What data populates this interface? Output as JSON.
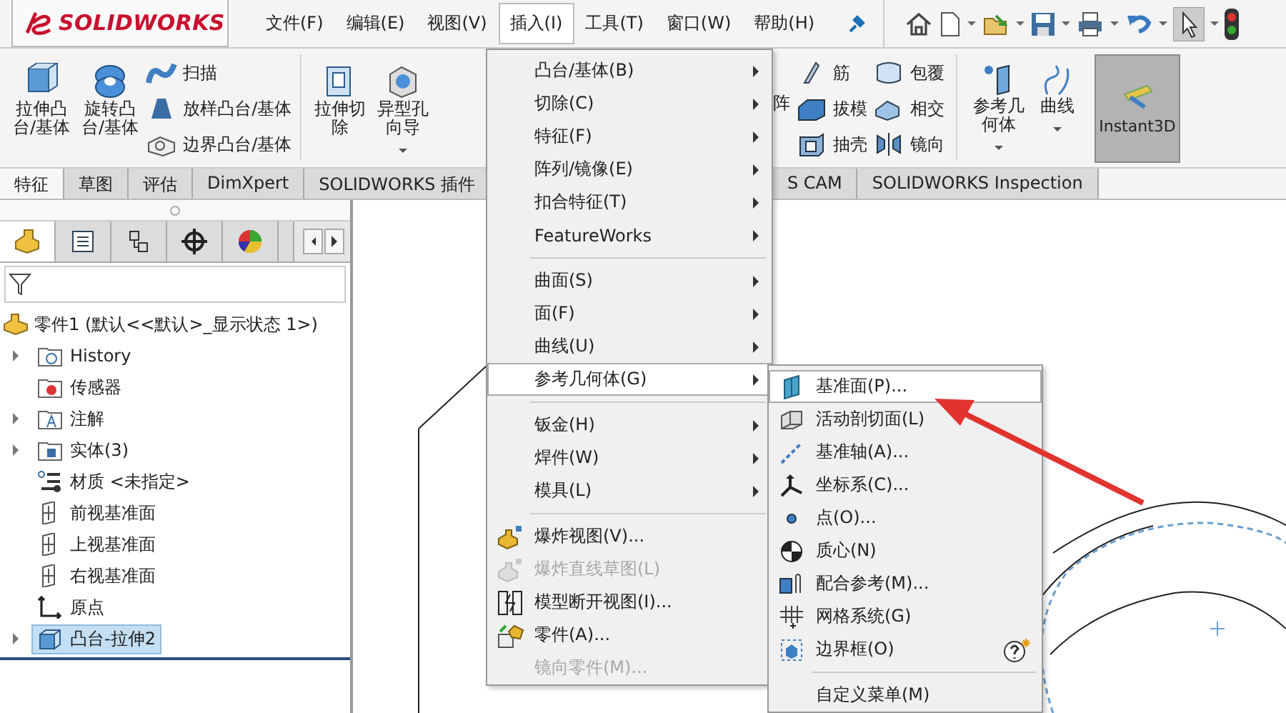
{
  "logo": {
    "text": "SOLIDWORKS"
  },
  "menubar": [
    {
      "label": "文件(F)",
      "selected": false
    },
    {
      "label": "编辑(E)",
      "selected": false
    },
    {
      "label": "视图(V)",
      "selected": false
    },
    {
      "label": "插入(I)",
      "selected": true
    },
    {
      "label": "工具(T)",
      "selected": false
    },
    {
      "label": "窗口(W)",
      "selected": false
    },
    {
      "label": "帮助(H)",
      "selected": false
    }
  ],
  "ribbon": {
    "large_left": [
      {
        "label": "拉伸凸台/基体"
      },
      {
        "label": "旋转凸台/基体"
      }
    ],
    "small_left": [
      {
        "label": "扫描"
      },
      {
        "label": "放样凸台/基体"
      },
      {
        "label": "边界凸台/基体"
      }
    ],
    "large_cut": [
      {
        "label": "拉伸切除",
        "dropdown": false
      },
      {
        "label": "异型孔向导",
        "dropdown": true
      }
    ],
    "partial_label": "阵",
    "small_columns": [
      [
        {
          "label": "筋"
        },
        {
          "label": "拔模"
        },
        {
          "label": "抽壳"
        }
      ],
      [
        {
          "label": "包覆"
        },
        {
          "label": "相交"
        },
        {
          "label": "镜向"
        }
      ]
    ],
    "large_right": [
      {
        "label": "参考几何体",
        "dropdown": true
      },
      {
        "label": "曲线",
        "dropdown": true
      }
    ],
    "instant3d": {
      "label": "Instant3D",
      "pressed": true
    }
  },
  "tabs_left": [
    {
      "label": "特征",
      "selected": true
    },
    {
      "label": "草图",
      "selected": false
    },
    {
      "label": "评估",
      "selected": false
    },
    {
      "label": "DimXpert",
      "selected": false
    },
    {
      "label": "SOLIDWORKS 插件",
      "selected": false
    }
  ],
  "tabs_right": [
    {
      "label": "S CAM",
      "selected": false
    },
    {
      "label": "SOLIDWORKS Inspection",
      "selected": false
    }
  ],
  "panel_tabs": [
    {
      "selected": true
    },
    {
      "selected": false
    },
    {
      "selected": false
    },
    {
      "selected": false
    },
    {
      "selected": false
    }
  ],
  "tree": {
    "label": "零件1  (默认<<默认>_显示状态 1>)",
    "children": [
      {
        "label": "History",
        "expandable": true,
        "selected": false
      },
      {
        "label": "传感器",
        "expandable": false,
        "selected": false
      },
      {
        "label": "注解",
        "expandable": true,
        "selected": false
      },
      {
        "label": "实体(3)",
        "expandable": true,
        "selected": false
      },
      {
        "label": "材质 <未指定>",
        "expandable": false,
        "selected": false
      },
      {
        "label": "前视基准面",
        "expandable": false,
        "selected": false
      },
      {
        "label": "上视基准面",
        "expandable": false,
        "selected": false
      },
      {
        "label": "右视基准面",
        "expandable": false,
        "selected": false
      },
      {
        "label": "原点",
        "expandable": false,
        "selected": false
      },
      {
        "label": "凸台-拉伸2",
        "expandable": true,
        "selected": true
      }
    ]
  },
  "insert_menu": [
    {
      "kind": "submenu",
      "label": "凸台/基体(B)",
      "selected": false,
      "disabled": false
    },
    {
      "kind": "submenu",
      "label": "切除(C)",
      "selected": false,
      "disabled": false
    },
    {
      "kind": "submenu",
      "label": "特征(F)",
      "selected": false,
      "disabled": false
    },
    {
      "kind": "submenu",
      "label": "阵列/镜像(E)",
      "selected": false,
      "disabled": false
    },
    {
      "kind": "submenu",
      "label": "扣合特征(T)",
      "selected": false,
      "disabled": false
    },
    {
      "kind": "submenu",
      "label": "FeatureWorks",
      "selected": false,
      "disabled": false
    },
    {
      "kind": "separator"
    },
    {
      "kind": "submenu",
      "label": "曲面(S)",
      "selected": false,
      "disabled": false
    },
    {
      "kind": "submenu",
      "label": "面(F)",
      "selected": false,
      "disabled": false
    },
    {
      "kind": "submenu",
      "label": "曲线(U)",
      "selected": false,
      "disabled": false
    },
    {
      "kind": "submenu",
      "label": "参考几何体(G)",
      "selected": true,
      "disabled": false
    },
    {
      "kind": "separator"
    },
    {
      "kind": "submenu",
      "label": "钣金(H)",
      "selected": false,
      "disabled": false
    },
    {
      "kind": "submenu",
      "label": "焊件(W)",
      "selected": false,
      "disabled": false
    },
    {
      "kind": "submenu",
      "label": "模具(L)",
      "selected": false,
      "disabled": false
    },
    {
      "kind": "separator"
    },
    {
      "kind": "command",
      "label": "爆炸视图(V)...",
      "selected": false,
      "disabled": false
    },
    {
      "kind": "command",
      "label": "爆炸直线草图(L)",
      "selected": false,
      "disabled": true
    },
    {
      "kind": "command",
      "label": "模型断开视图(I)...",
      "selected": false,
      "disabled": false
    },
    {
      "kind": "command",
      "label": "零件(A)...",
      "selected": false,
      "disabled": false
    },
    {
      "kind": "command",
      "label": "镜向零件(M)...",
      "selected": false,
      "disabled": true
    }
  ],
  "reference_submenu": [
    {
      "kind": "command",
      "label": "基准面(P)...",
      "selected": true
    },
    {
      "kind": "command",
      "label": "活动剖切面(L)",
      "selected": false
    },
    {
      "kind": "command",
      "label": "基准轴(A)...",
      "selected": false
    },
    {
      "kind": "command",
      "label": "坐标系(C)...",
      "selected": false
    },
    {
      "kind": "command",
      "label": "点(O)...",
      "selected": false
    },
    {
      "kind": "command",
      "label": "质心(N)",
      "selected": false
    },
    {
      "kind": "command",
      "label": "配合参考(M)...",
      "selected": false
    },
    {
      "kind": "command",
      "label": "网格系统(G)",
      "selected": false
    },
    {
      "kind": "command",
      "label": "边界框(O)",
      "selected": false
    },
    {
      "kind": "separator"
    },
    {
      "kind": "command",
      "label": "自定义菜单(M)",
      "selected": false
    }
  ]
}
